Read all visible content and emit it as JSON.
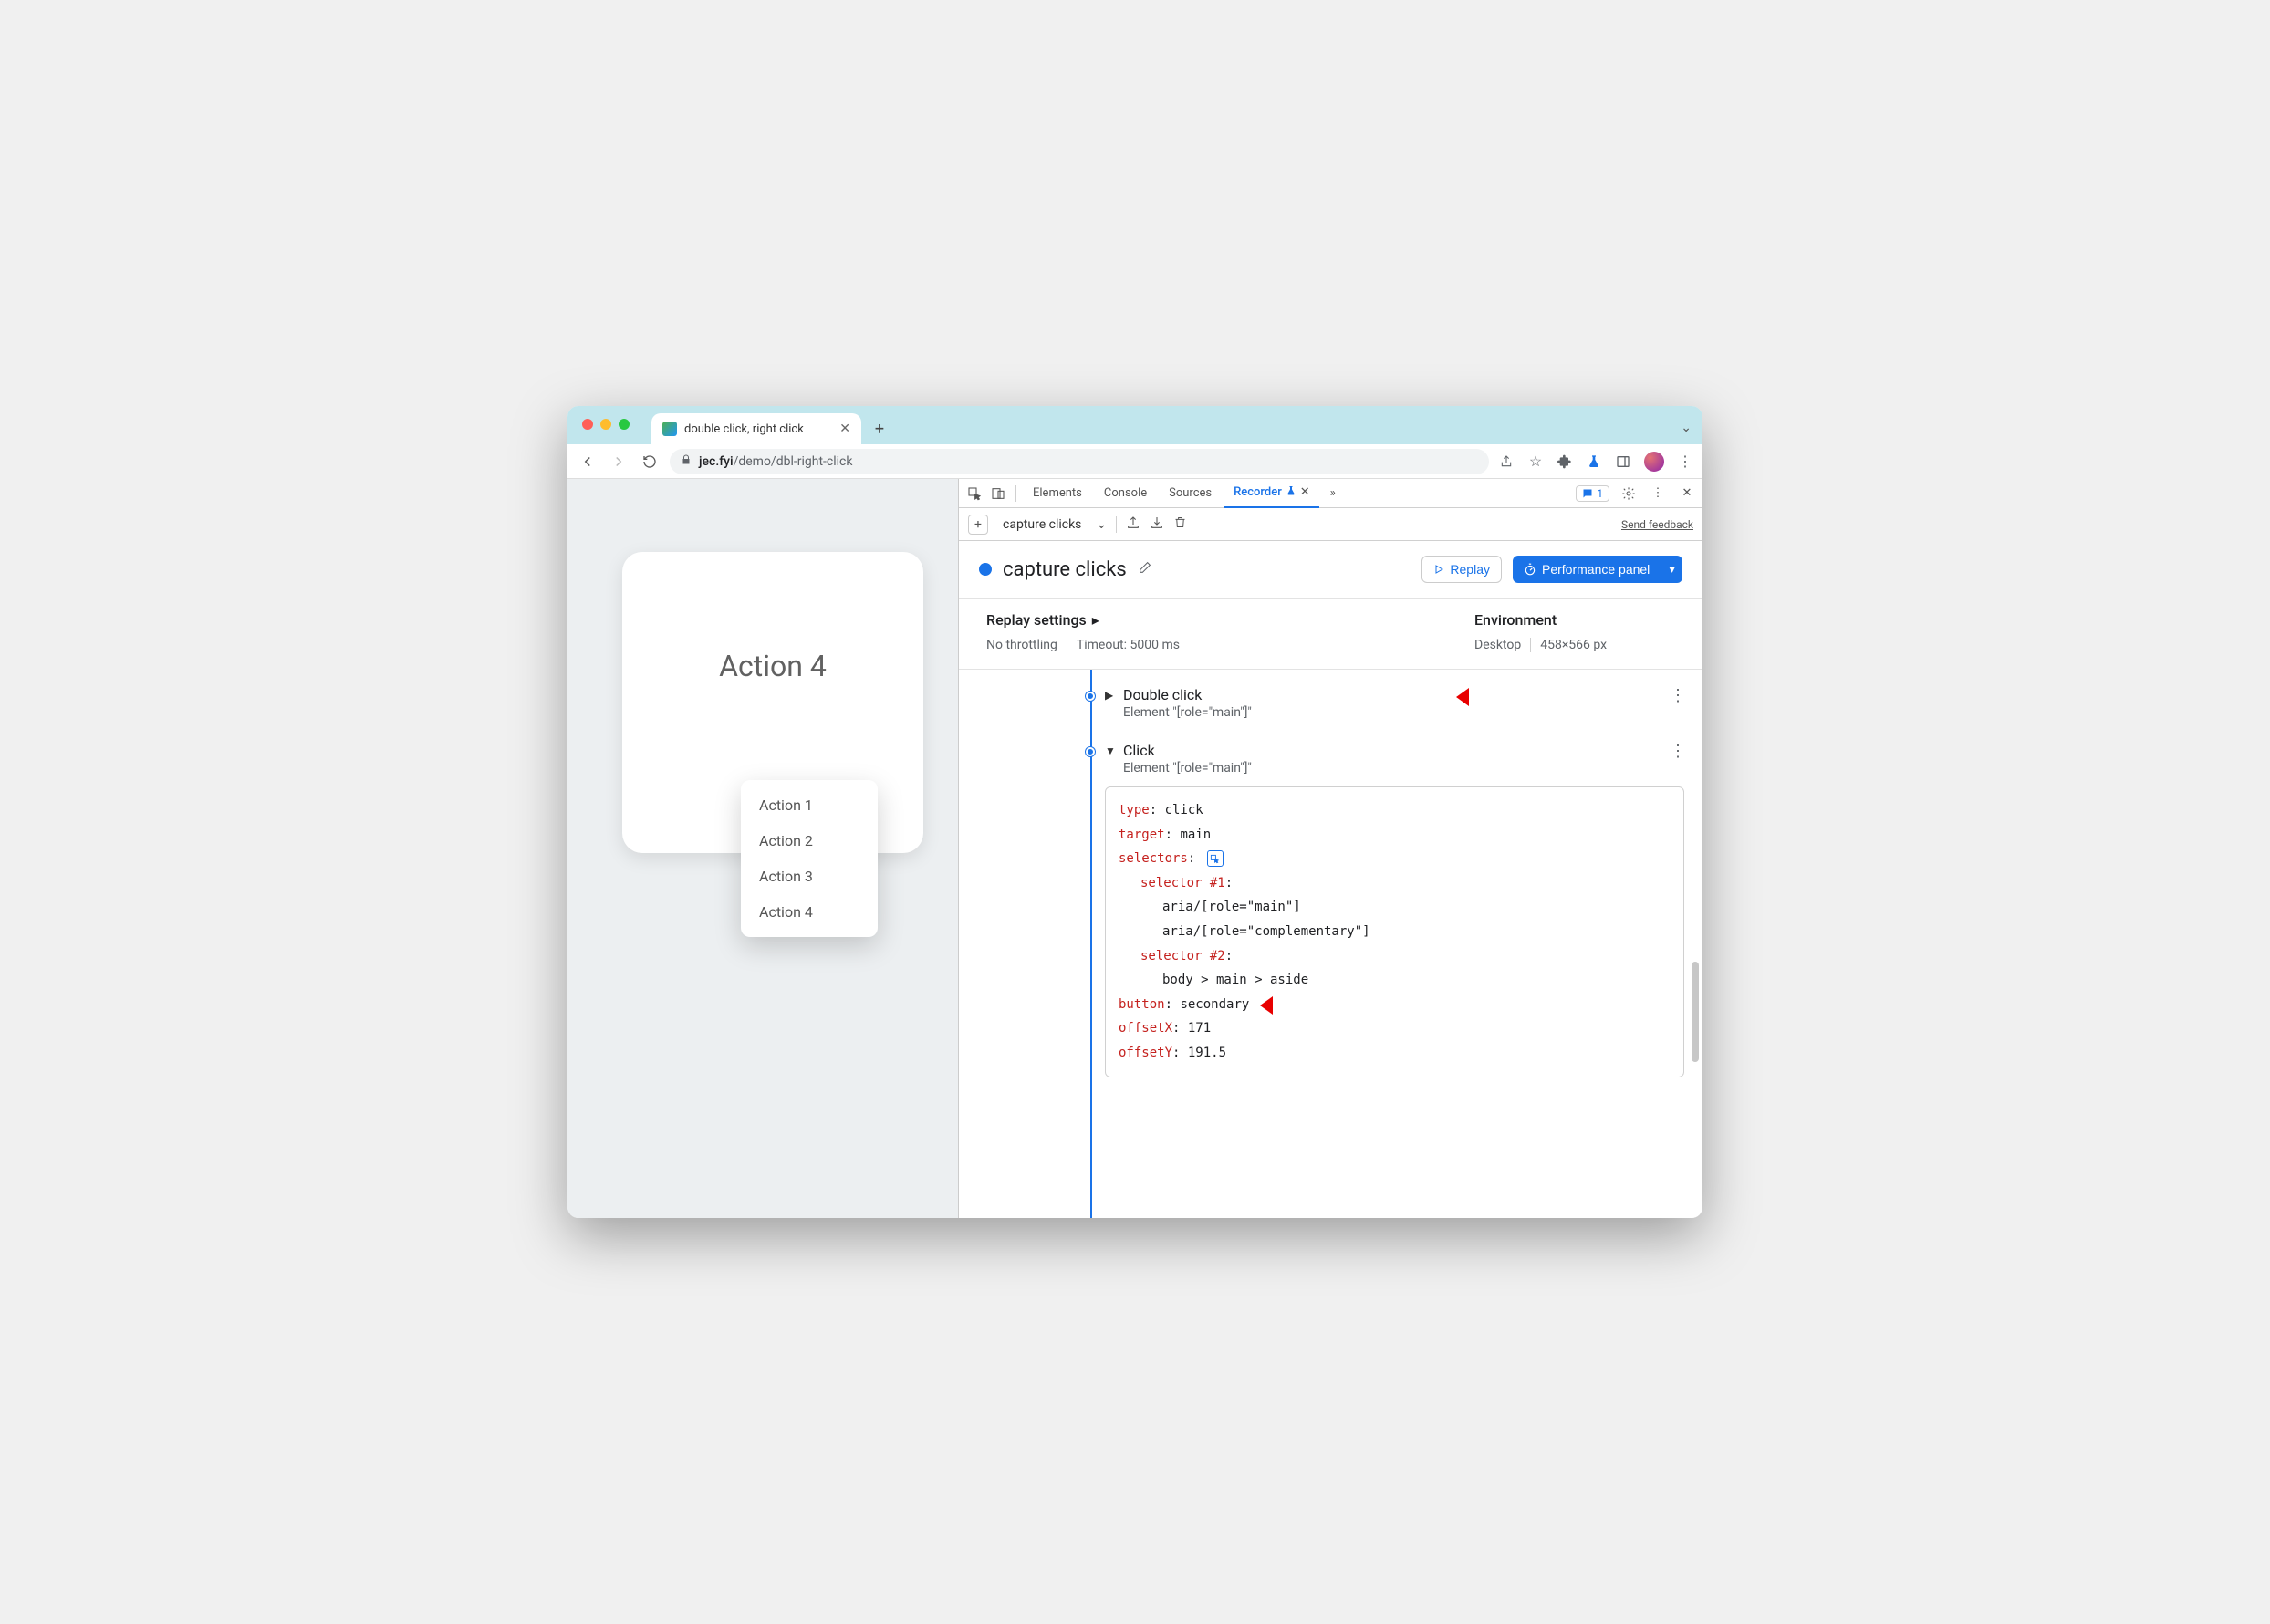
{
  "tab": {
    "title": "double click, right click"
  },
  "url": {
    "host": "jec.fyi",
    "path": "/demo/dbl-right-click"
  },
  "devtools": {
    "tabs": {
      "elements": "Elements",
      "console": "Console",
      "sources": "Sources",
      "recorder": "Recorder"
    },
    "issues_count": "1",
    "send_feedback": "Send feedback"
  },
  "recorder": {
    "recording_name": "capture clicks",
    "title": "capture clicks",
    "replay_btn": "Replay",
    "perf_btn": "Performance panel"
  },
  "settings": {
    "replay_label": "Replay settings",
    "throttling": "No throttling",
    "timeout": "Timeout: 5000 ms",
    "env_label": "Environment",
    "device": "Desktop",
    "viewport": "458×566 px"
  },
  "page": {
    "card_title": "Action 4",
    "menu": [
      "Action 1",
      "Action 2",
      "Action 3",
      "Action 4"
    ]
  },
  "steps": [
    {
      "title": "Double click",
      "subtitle": "Element \"[role=\"main\"]\"",
      "expanded": false
    },
    {
      "title": "Click",
      "subtitle": "Element \"[role=\"main\"]\"",
      "expanded": true,
      "detail": {
        "type_k": "type",
        "type_v": "click",
        "target_k": "target",
        "target_v": "main",
        "selectors_k": "selectors",
        "sel1_k": "selector #1",
        "sel1_a": "aria/[role=\"main\"]",
        "sel1_b": "aria/[role=\"complementary\"]",
        "sel2_k": "selector #2",
        "sel2_a": "body > main > aside",
        "button_k": "button",
        "button_v": "secondary",
        "offx_k": "offsetX",
        "offx_v": "171",
        "offy_k": "offsetY",
        "offy_v": "191.5"
      }
    }
  ]
}
